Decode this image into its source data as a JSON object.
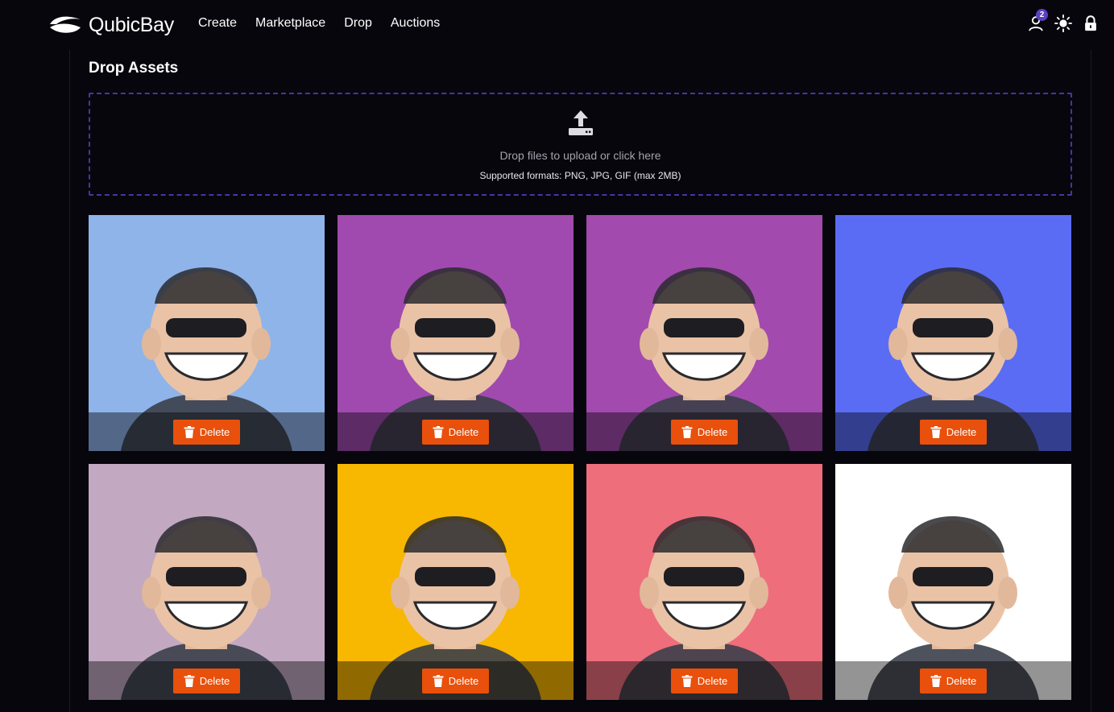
{
  "app": {
    "name": "QubicBay",
    "logo_icon": "wave-logo-icon"
  },
  "nav": {
    "links": [
      "Create",
      "Marketplace",
      "Drop",
      "Auctions"
    ],
    "icons": [
      {
        "name": "user-icon",
        "badge": "2"
      },
      {
        "name": "sun-icon"
      },
      {
        "name": "lock-icon"
      }
    ]
  },
  "page": {
    "title": "Drop Assets"
  },
  "dropzone": {
    "icon": "upload-icon",
    "text": "Drop files to upload or click here",
    "formats": "Supported formats: PNG, JPG, GIF (max 2MB)"
  },
  "assets": [
    {
      "background": "#8fb4ea",
      "delete_label": "Delete"
    },
    {
      "background": "#a04ab0",
      "delete_label": "Delete"
    },
    {
      "background": "#a34aae",
      "delete_label": "Delete"
    },
    {
      "background": "#5b6cf4",
      "delete_label": "Delete"
    },
    {
      "background": "#c2a9c1",
      "delete_label": "Delete"
    },
    {
      "background": "#f8b700",
      "delete_label": "Delete"
    },
    {
      "background": "#ee6e7c",
      "delete_label": "Delete"
    },
    {
      "background": "#ffffff",
      "delete_label": "Delete"
    }
  ],
  "colors": {
    "background": "#07060d",
    "accent": "#5b3fc4",
    "dropzone_border": "#4a33a3",
    "delete_button": "#e8500c"
  }
}
